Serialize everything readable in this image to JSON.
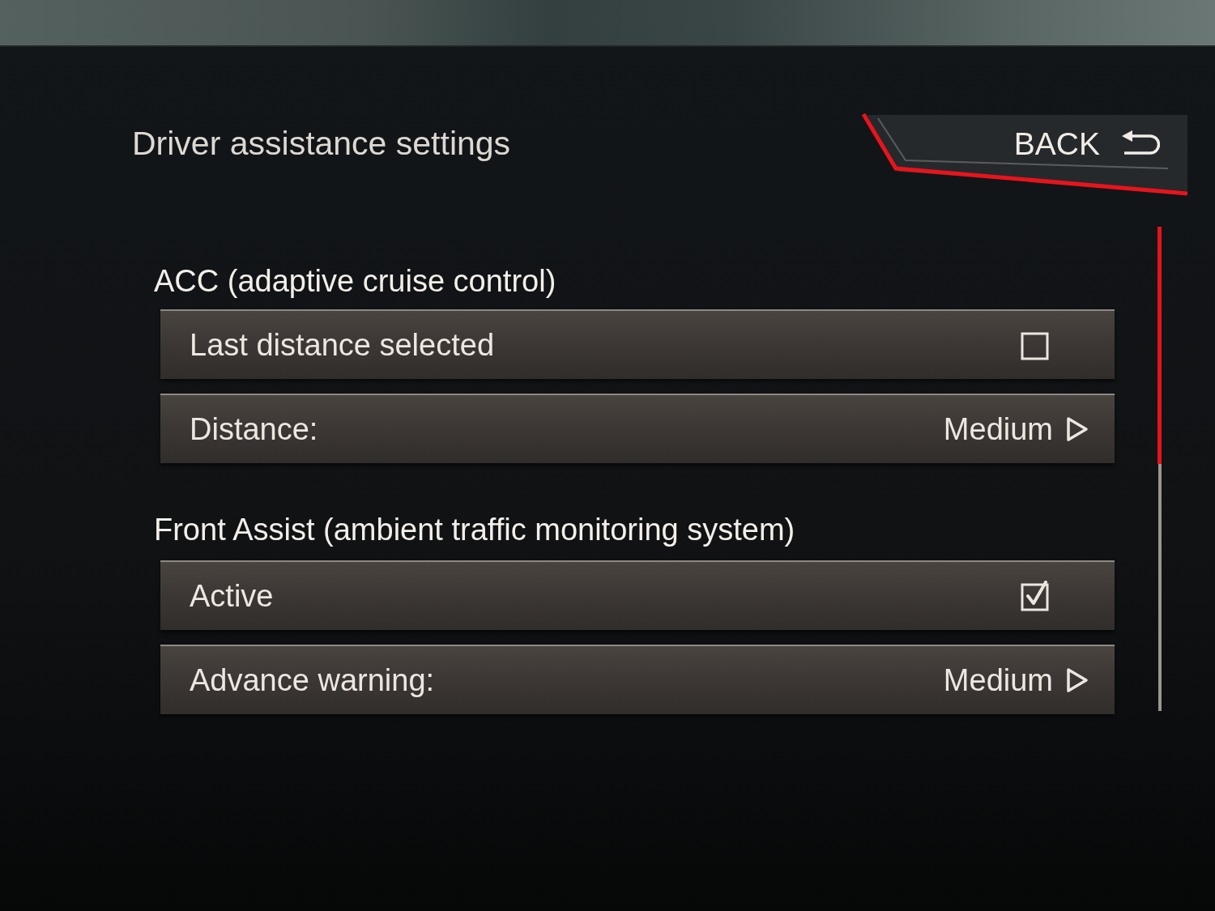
{
  "screen": {
    "title": "Driver assistance settings",
    "back_button": {
      "label": "BACK"
    }
  },
  "sections": [
    {
      "heading": "ACC (adaptive cruise control)",
      "items": [
        {
          "kind": "checkbox",
          "label": "Last distance selected",
          "checked": false
        },
        {
          "kind": "option",
          "label": "Distance:",
          "value": "Medium"
        }
      ]
    },
    {
      "heading": "Front Assist (ambient traffic monitoring system)",
      "items": [
        {
          "kind": "checkbox",
          "label": "Active",
          "checked": true
        },
        {
          "kind": "option",
          "label": "Advance warning:",
          "value": "Medium"
        }
      ]
    }
  ]
}
